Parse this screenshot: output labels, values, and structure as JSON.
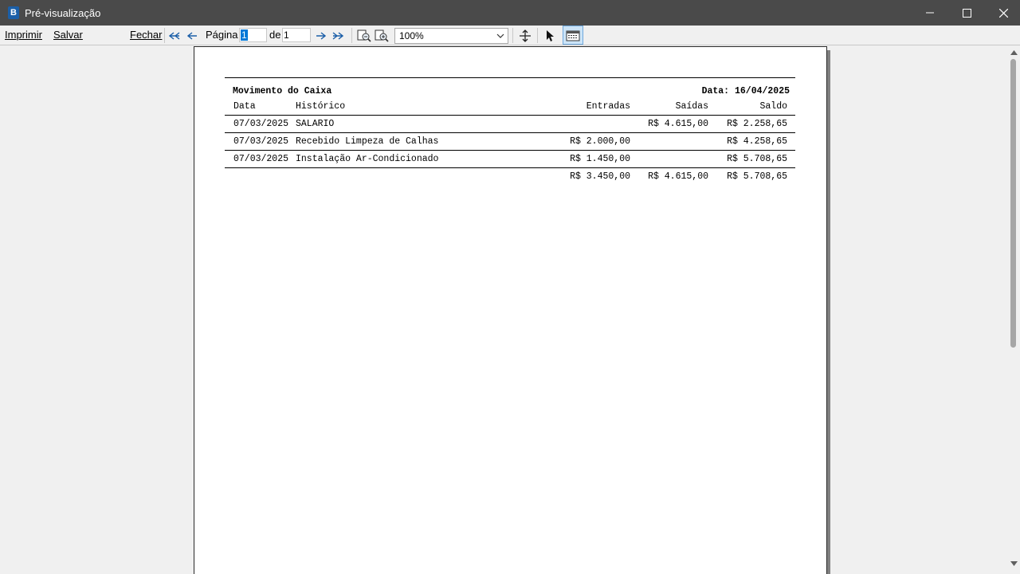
{
  "window": {
    "title": "Pré-visualização",
    "icon": "app-logo-icon"
  },
  "toolbar": {
    "print_label": "Imprimir",
    "save_label": "Salvar",
    "close_label": "Fechar",
    "page_label": "Página",
    "page_value": "1",
    "of_label": "de",
    "total_pages": "1",
    "zoom_value": "100%"
  },
  "report": {
    "title": "Movimento do Caixa",
    "date_label": "Data: 16/04/2025",
    "columns": [
      "Data",
      "Histórico",
      "Entradas",
      "Saídas",
      "Saldo"
    ],
    "rows": [
      {
        "data": "07/03/2025",
        "historico": "SALARIO",
        "entradas": "",
        "saidas": "R$ 4.615,00",
        "saldo": "R$ 2.258,65"
      },
      {
        "data": "07/03/2025",
        "historico": "Recebido Limpeza de Calhas",
        "entradas": "R$ 2.000,00",
        "saidas": "",
        "saldo": "R$ 4.258,65"
      },
      {
        "data": "07/03/2025",
        "historico": "Instalação Ar-Condicionado",
        "entradas": "R$ 1.450,00",
        "saidas": "",
        "saldo": "R$ 5.708,65"
      }
    ],
    "totals": {
      "entradas": "R$ 3.450,00",
      "saidas": "R$ 4.615,00",
      "saldo": "R$ 5.708,65"
    }
  },
  "colors": {
    "titlebar": "#4a4a4a",
    "accent": "#0078d7",
    "nav_arrow": "#1b5fa8"
  }
}
